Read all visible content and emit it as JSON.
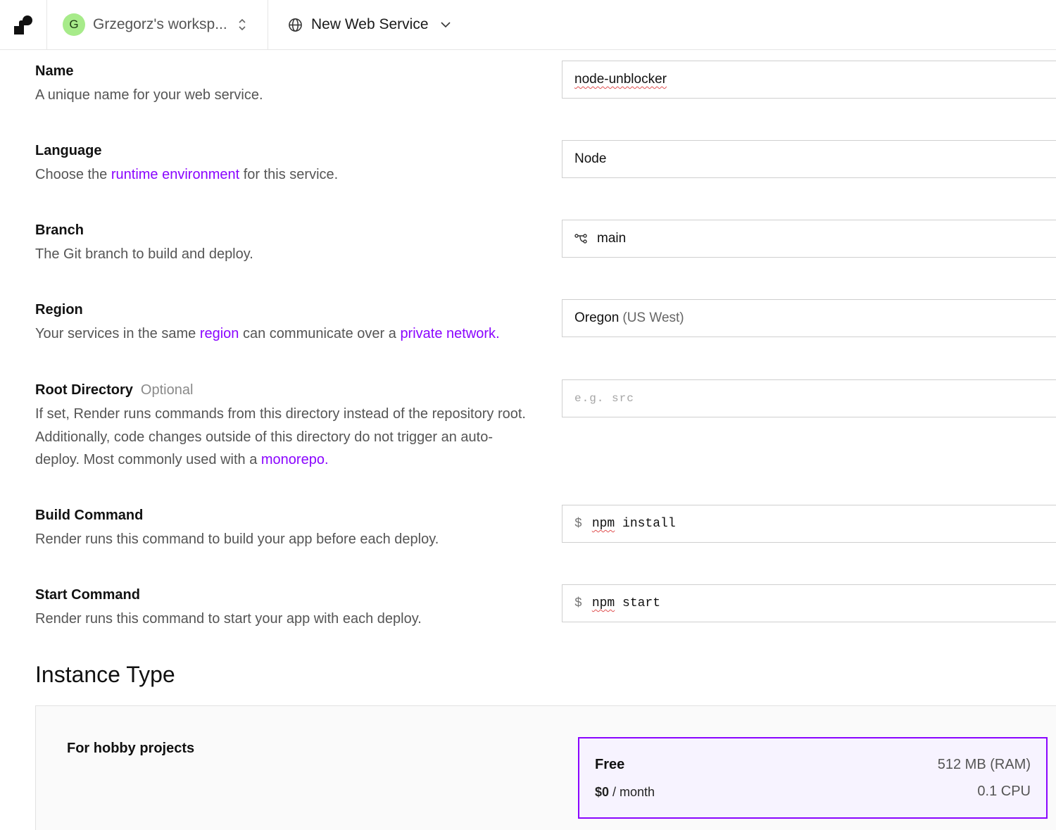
{
  "topbar": {
    "workspace_initial": "G",
    "workspace_name": "Grzegorz's worksp...",
    "service_title": "New Web Service"
  },
  "fields": {
    "name": {
      "label": "Name",
      "description": "A unique name for your web service.",
      "value": "node-unblocker"
    },
    "language": {
      "label": "Language",
      "desc_before": "Choose the ",
      "desc_link": "runtime environment",
      "desc_after": " for this service.",
      "value": "Node"
    },
    "branch": {
      "label": "Branch",
      "description": "The Git branch to build and deploy.",
      "value": "main"
    },
    "region": {
      "label": "Region",
      "desc_before": "Your services in the same ",
      "desc_link1": "region",
      "desc_middle": " can communicate over a ",
      "desc_link2": "private network",
      "desc_after": ".",
      "value": "Oregon",
      "value_sub": "(US West)"
    },
    "root_directory": {
      "label": "Root Directory",
      "optional": "Optional",
      "desc_before": "If set, Render runs commands from this directory instead of the repository root. Additionally, code changes outside of this directory do not trigger an auto-deploy. Most commonly used with a ",
      "desc_link": "monorepo",
      "desc_after": ".",
      "placeholder": "e.g. src"
    },
    "build_command": {
      "label": "Build Command",
      "description": "Render runs this command to build your app before each deploy.",
      "prompt": "$",
      "value_word1": "npm",
      "value_rest": " install"
    },
    "start_command": {
      "label": "Start Command",
      "description": "Render runs this command to start your app with each deploy.",
      "prompt": "$",
      "value_word1": "npm",
      "value_rest": " start"
    }
  },
  "instance": {
    "heading": "Instance Type",
    "group_label": "For hobby projects",
    "plan": {
      "name": "Free",
      "price": "$0",
      "period": " / month",
      "ram": "512 MB (RAM)",
      "cpu": "0.1 CPU"
    }
  },
  "colors": {
    "accent": "#8a05ff",
    "avatar_bg": "#a7eb8a",
    "selected_card_bg": "#f7f3ff"
  },
  "icons": [
    "render-logo-icon",
    "chevron-up-down-icon",
    "globe-icon",
    "chevron-down-icon",
    "git-branch-icon"
  ]
}
